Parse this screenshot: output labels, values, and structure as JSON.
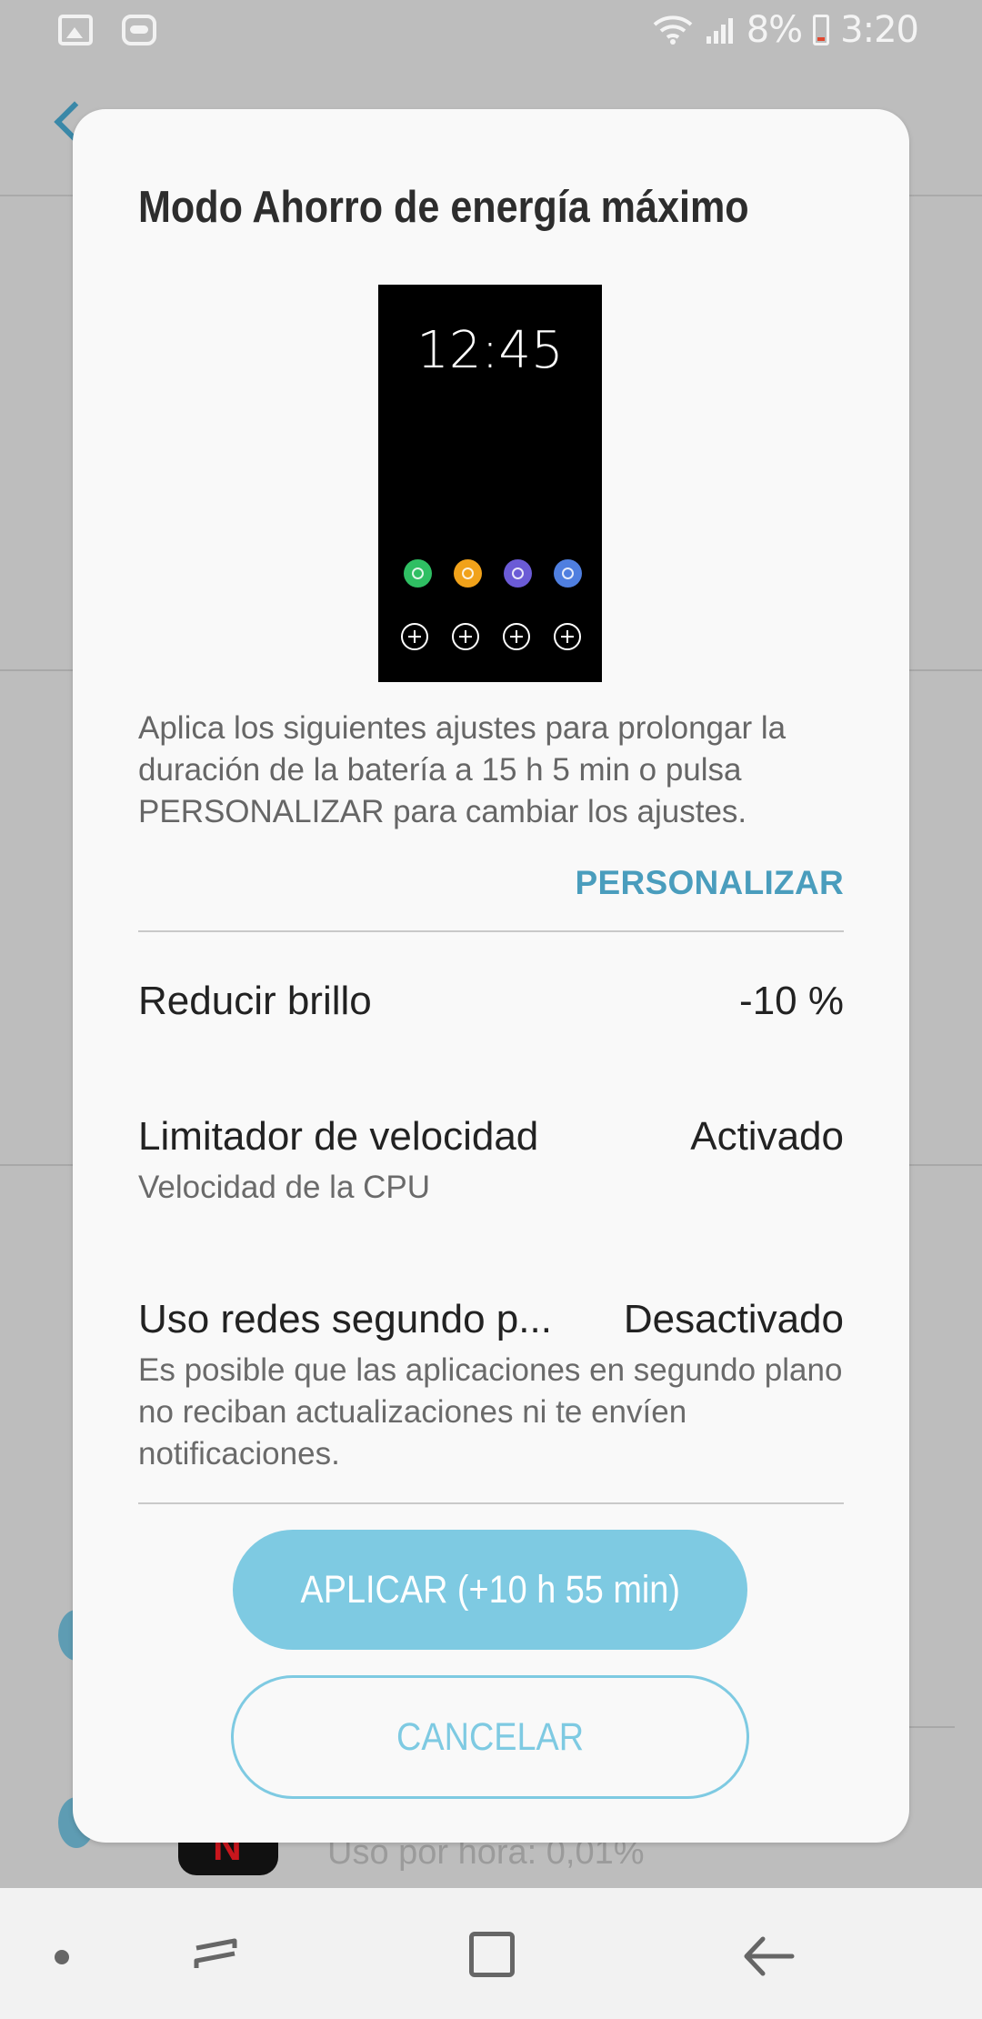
{
  "status_bar": {
    "battery": "8%",
    "time": "3:20",
    "icons": [
      "image-notification-icon",
      "bot-notification-icon",
      "wifi-icon",
      "signal-icon",
      "battery-icon"
    ]
  },
  "background": {
    "usage_text": "Uso por hora: 0,01%"
  },
  "dialog": {
    "title": "Modo Ahorro de energía máximo",
    "preview": {
      "clock": "12:45",
      "apps": [
        "phone-icon",
        "messages-icon",
        "internet-icon",
        "settings-icon"
      ]
    },
    "description": "Aplica los siguientes ajustes para prolongar la duración de la batería a 15 h 5 min o pulsa PERSONALIZAR para cambiar los ajustes.",
    "customize_label": "PERSONALIZAR",
    "settings": [
      {
        "title": "Reducir brillo",
        "value": "-10 %",
        "subtitle": ""
      },
      {
        "title": "Limitador de velocidad",
        "value": "Activado",
        "subtitle": "Velocidad de la CPU"
      },
      {
        "title": "Uso redes segundo p...",
        "value": "Desactivado",
        "subtitle": "Es posible que las aplicaciones en segundo plano no reciban actualizaciones ni te envíen notificaciones."
      }
    ],
    "apply_label": "APLICAR (+10 h 55 min)",
    "cancel_label": "CANCELAR"
  },
  "colors": {
    "accent": "#4a9dbd",
    "button": "#7ecae2",
    "dialog_bg": "#f9f9f9",
    "scrim": "#bdbdbd"
  }
}
